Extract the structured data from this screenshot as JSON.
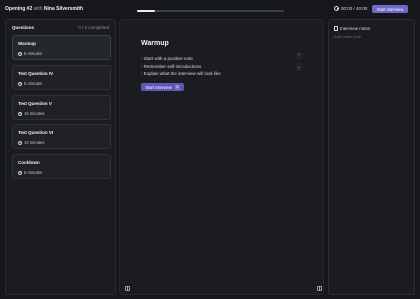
{
  "header": {
    "title_bold": "Opening #2",
    "title_with": "with",
    "candidate": "Nina Silversmith",
    "timer": "00:00 / 40:00",
    "start_button": "Start interview"
  },
  "sidebar": {
    "heading": "Questions",
    "completed": "0 / 5 completed",
    "questions": [
      {
        "title": "Warmup",
        "duration": "5 minutes"
      },
      {
        "title": "Test Question IV",
        "duration": "5 minutes"
      },
      {
        "title": "Test Question V",
        "duration": "15 minutes"
      },
      {
        "title": "Test Question VI",
        "duration": "10 minutes"
      },
      {
        "title": "Cooldown",
        "duration": "5 minutes"
      }
    ]
  },
  "main": {
    "title": "Warmup",
    "bullets": [
      "Start with a positive note",
      "Remember self-introductions",
      "Explain what the interview will look like"
    ],
    "start_button": "Start interview",
    "shortcut": "S",
    "nav_up": "⌃",
    "nav_down": "⌄"
  },
  "notes": {
    "heading": "Interview notes",
    "placeholder": "Add notes here"
  },
  "colors": {
    "background": "#15171b",
    "panel": "#1a1c20",
    "accent": "#6c6ac9"
  }
}
